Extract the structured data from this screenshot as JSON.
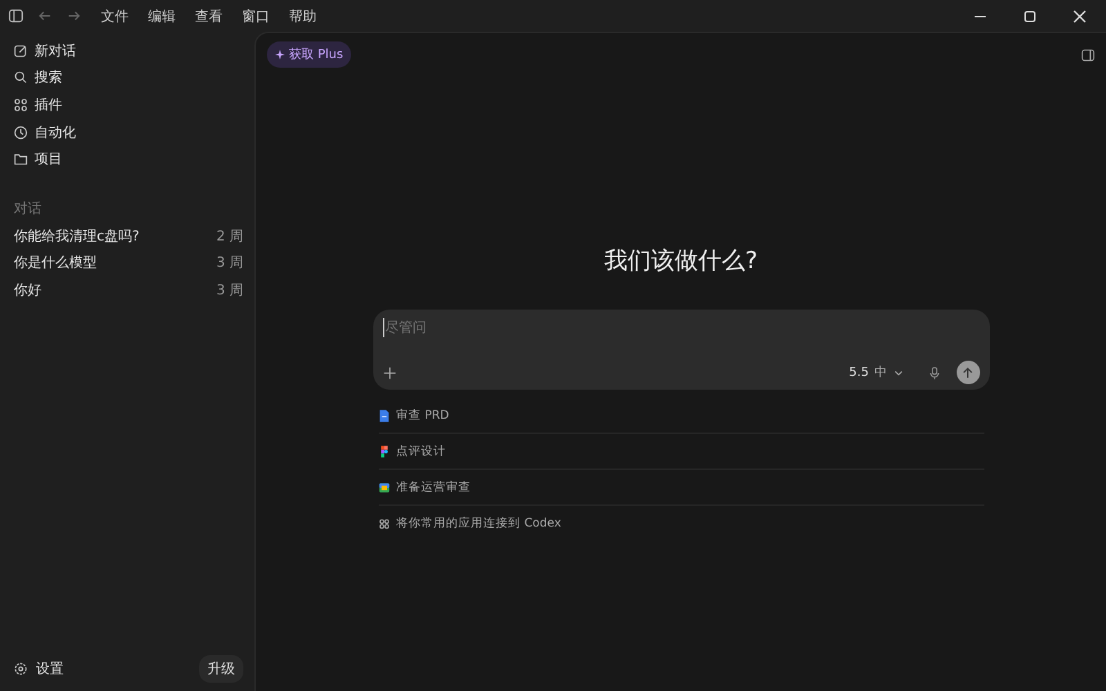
{
  "menu": [
    "文件",
    "编辑",
    "查看",
    "窗口",
    "帮助"
  ],
  "sidebar": {
    "items": [
      {
        "label": "新对话",
        "kind": "edit"
      },
      {
        "label": "搜索",
        "kind": "search"
      },
      {
        "label": "插件",
        "kind": "apps"
      },
      {
        "label": "自动化",
        "kind": "clock"
      },
      {
        "label": "项目",
        "kind": "folder"
      }
    ],
    "section_title": "对话",
    "conversations": [
      {
        "title": "你能给我清理c盘吗?",
        "age": "2 周"
      },
      {
        "title": "你是什么模型",
        "age": "3 周"
      },
      {
        "title": "你好",
        "age": "3 周"
      }
    ],
    "settings": "设置",
    "upgrade": "升级"
  },
  "plus_badge": "获取 Plus",
  "heading": "我们该做什么?",
  "composer": {
    "placeholder": "尽管问",
    "model": "5.5",
    "effort": "中"
  },
  "suggestions": [
    {
      "label": "审查 PRD",
      "kind": "doc"
    },
    {
      "label": "点评设计",
      "kind": "figma"
    },
    {
      "label": "准备运营审查",
      "kind": "slides"
    },
    {
      "label": "将你常用的应用连接到 Codex",
      "kind": "apps"
    }
  ]
}
